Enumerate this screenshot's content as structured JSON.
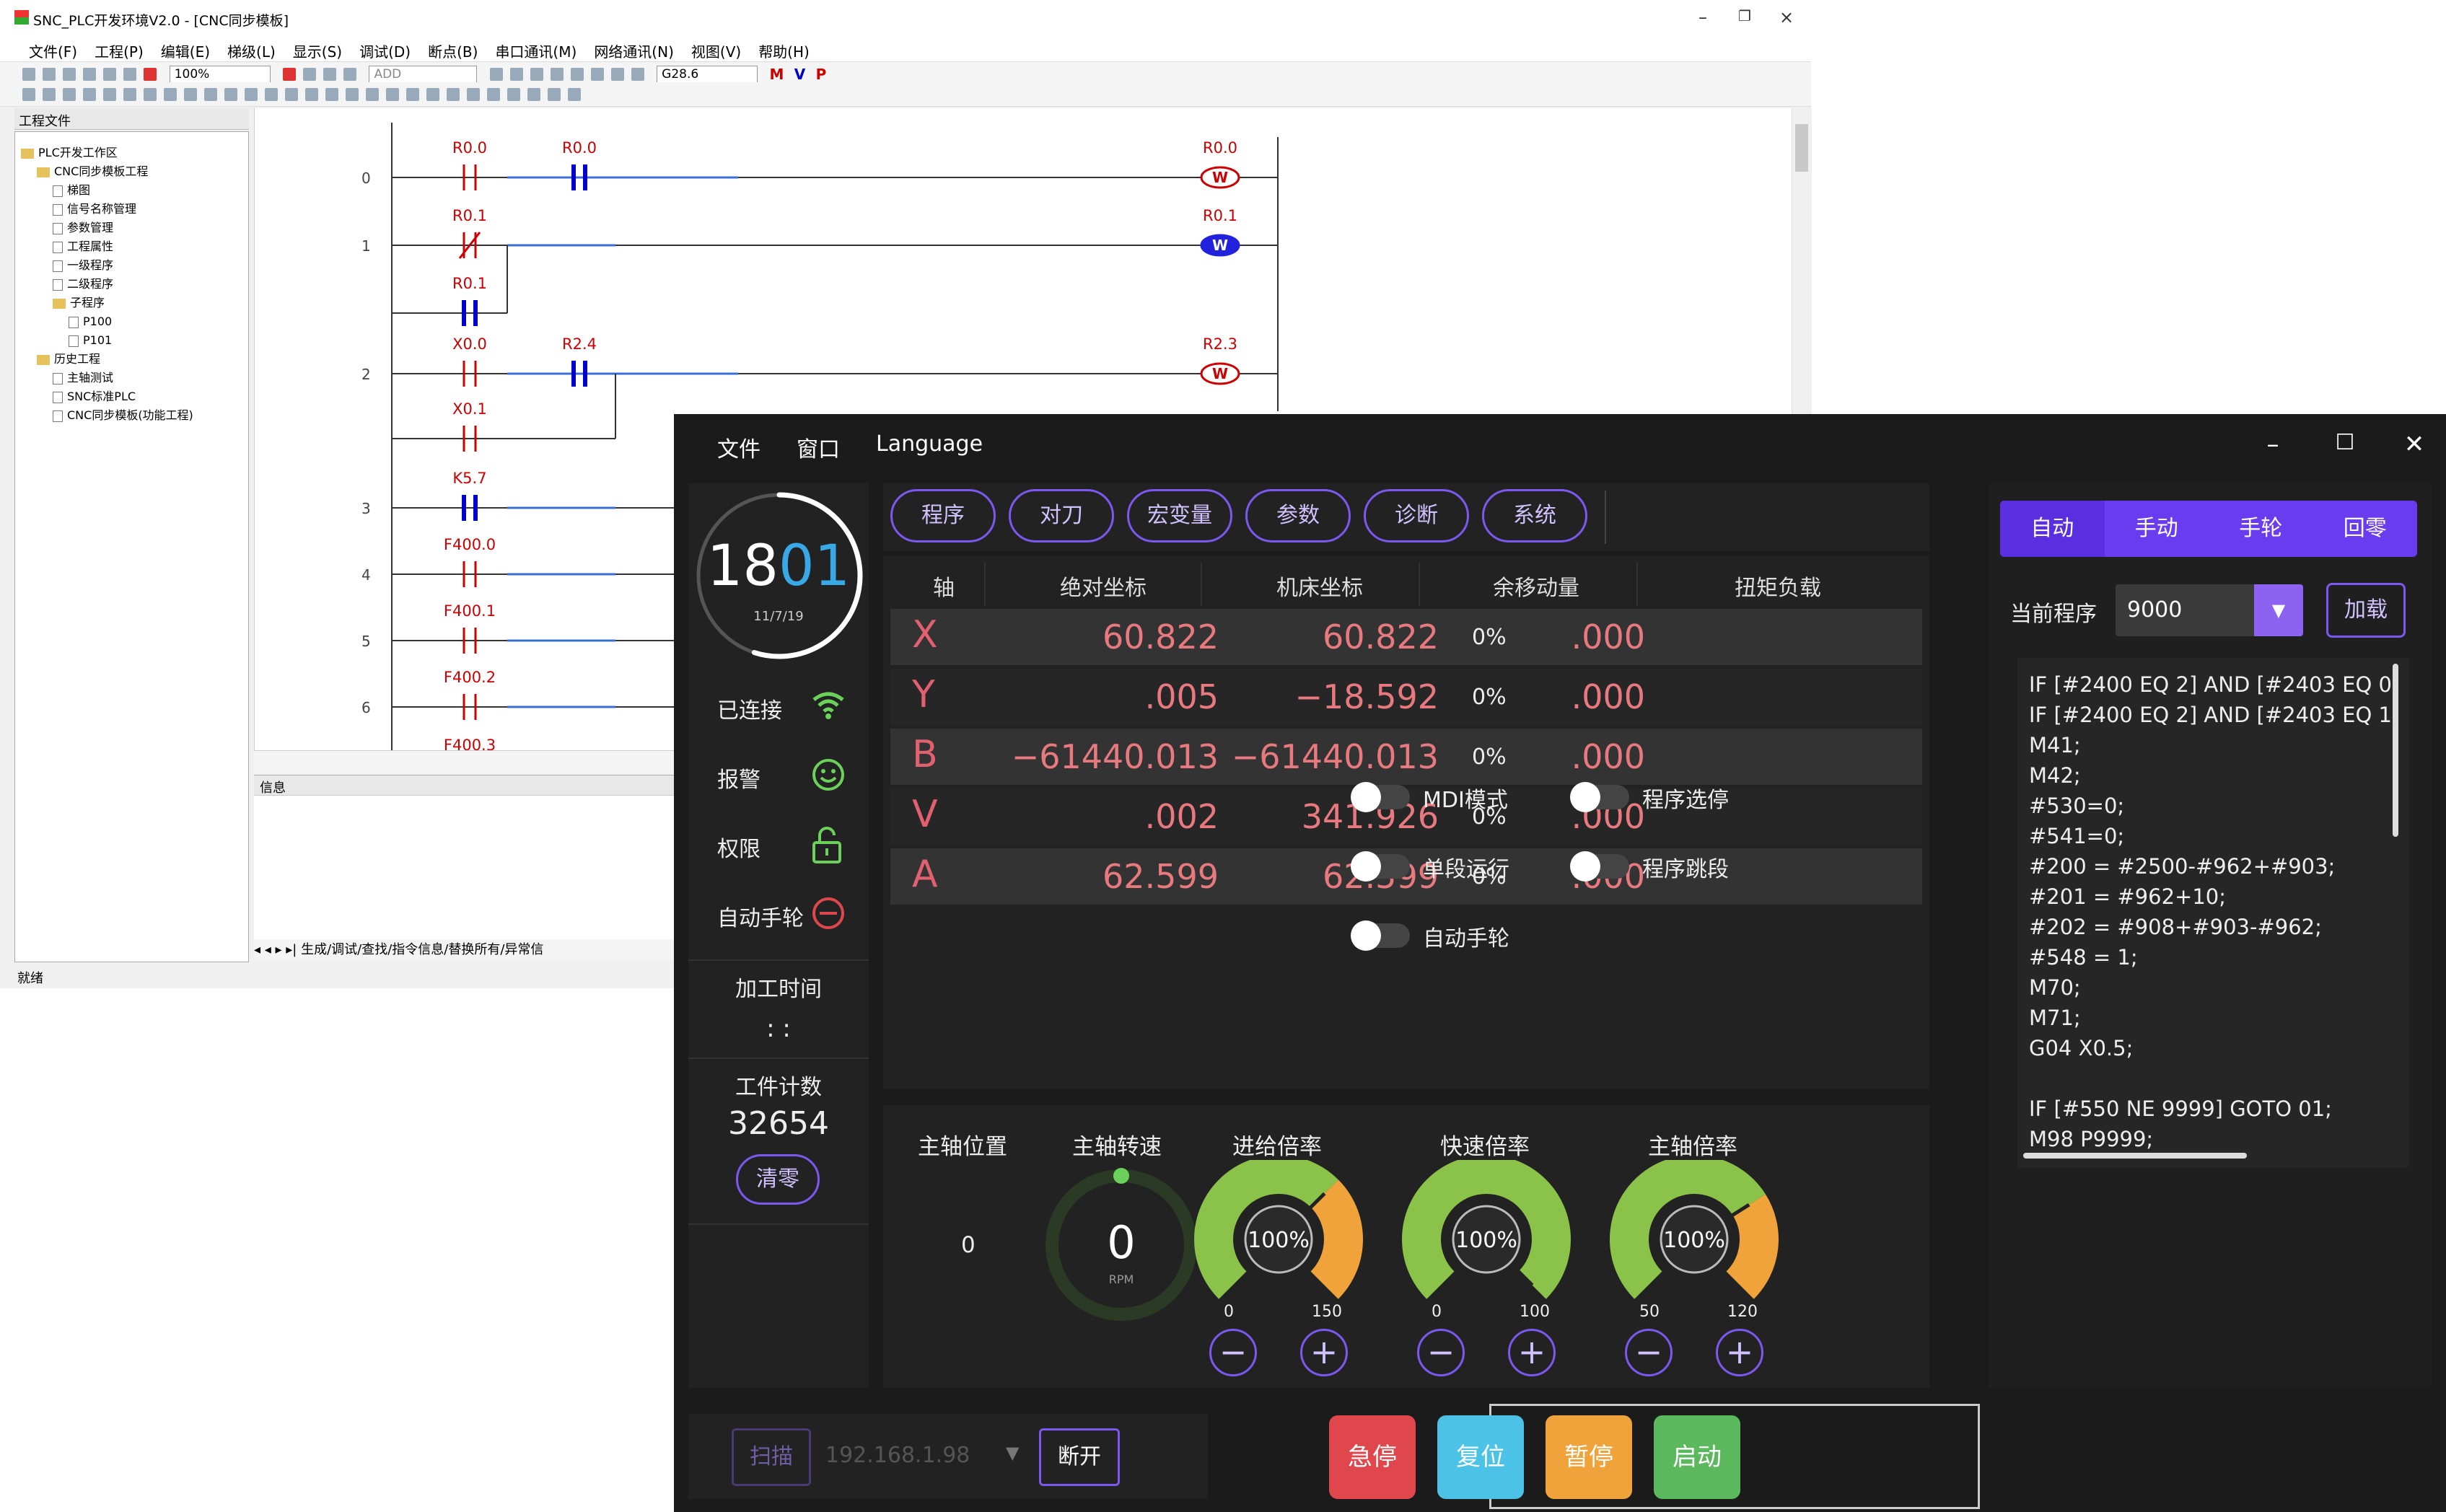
{
  "plc": {
    "title": "SNC_PLC开发环境V2.0 - [CNC同步模板]",
    "menu": [
      "文件(F)",
      "工程(P)",
      "编辑(E)",
      "梯级(L)",
      "显示(S)",
      "调试(D)",
      "断点(B)",
      "串口通讯(M)",
      "网络通讯(N)",
      "视图(V)",
      "帮助(H)"
    ],
    "zoom": "100%",
    "ins_field": "ADD",
    "coord_field": "G28.6",
    "toolbar_letters": [
      "M",
      "V",
      "P"
    ],
    "tree_header": "工程文件",
    "tree": [
      {
        "label": "PLC开发工作区",
        "level": 0,
        "type": "folder"
      },
      {
        "label": "CNC同步模板工程",
        "level": 1,
        "type": "folder"
      },
      {
        "label": "梯图",
        "level": 2,
        "type": "file"
      },
      {
        "label": "信号名称管理",
        "level": 2,
        "type": "file"
      },
      {
        "label": "参数管理",
        "level": 2,
        "type": "file"
      },
      {
        "label": "工程属性",
        "level": 2,
        "type": "file"
      },
      {
        "label": "一级程序",
        "level": 2,
        "type": "file"
      },
      {
        "label": "二级程序",
        "level": 2,
        "type": "file"
      },
      {
        "label": "子程序",
        "level": 2,
        "type": "folder"
      },
      {
        "label": "P100",
        "level": 3,
        "type": "file"
      },
      {
        "label": "P101",
        "level": 3,
        "type": "file"
      },
      {
        "label": "历史工程",
        "level": 1,
        "type": "folder"
      },
      {
        "label": "主轴测试",
        "level": 2,
        "type": "file"
      },
      {
        "label": "SNC标准PLC",
        "level": 2,
        "type": "file"
      },
      {
        "label": "CNC同步模板(功能工程)",
        "level": 2,
        "type": "file"
      }
    ],
    "rungs": [
      {
        "n": "0",
        "c1": "R0.0",
        "c2": "R0.0",
        "coil": "R0.0"
      },
      {
        "n": "1",
        "c1": "R0.1",
        "c2": "",
        "coil": "R0.1",
        "branch": "R0.1"
      },
      {
        "n": "2",
        "c1": "X0.0",
        "c2": "R2.4",
        "coil": "R2.3",
        "branch": "X0.1"
      },
      {
        "n": "3",
        "c1": "K5.7",
        "c2": "",
        "coil": ""
      },
      {
        "n": "4",
        "c1": "F400.0",
        "c2": "",
        "coil": ""
      },
      {
        "n": "5",
        "c1": "F400.1",
        "c2": "",
        "coil": ""
      },
      {
        "n": "6",
        "c1": "F400.2",
        "c2": "",
        "coil": ""
      },
      {
        "n": "",
        "c1": "F400.3",
        "c2": "",
        "coil": ""
      }
    ],
    "info_label": "信息",
    "bottom_tabs": "生成/调试/查找/指令信息/替换所有/异常信",
    "status": "就绪"
  },
  "cnc": {
    "menu": [
      "文件",
      "窗口",
      "Language"
    ],
    "clock": {
      "hour": "18",
      "minute": "01",
      "date": "11/7/19"
    },
    "status": [
      {
        "label": "已连接",
        "icon": "wifi-icon"
      },
      {
        "label": "报警",
        "icon": "smiley-icon"
      },
      {
        "label": "权限",
        "icon": "unlock-icon"
      },
      {
        "label": "自动手轮",
        "icon": "minus-circle-icon"
      }
    ],
    "machining_time_label": "加工时间",
    "machining_time": ": :",
    "count_label": "工件计数",
    "count": "32654",
    "clear_label": "清零",
    "tabs": [
      "程序",
      "对刀",
      "宏变量",
      "参数",
      "诊断",
      "系统"
    ],
    "table_headers": [
      "轴",
      "绝对坐标",
      "机床坐标",
      "余移动量",
      "扭矩负载"
    ],
    "axes": [
      {
        "axis": "X",
        "abs": "60.822",
        "mach": "60.822",
        "remain": ".000",
        "load": "0%"
      },
      {
        "axis": "Y",
        "abs": ".005",
        "mach": "−18.592",
        "remain": ".000",
        "load": "0%"
      },
      {
        "axis": "B",
        "abs": "−61440.013",
        "mach": "−61440.013",
        "remain": ".000",
        "load": "0%"
      },
      {
        "axis": "V",
        "abs": ".002",
        "mach": "341.926",
        "remain": ".000",
        "load": "0%"
      },
      {
        "axis": "A",
        "abs": "62.599",
        "mach": "62.599",
        "remain": ".000",
        "load": "0%"
      }
    ],
    "spindle_pos_label": "主轴位置",
    "spindle_pos": "0",
    "spindle_speed_label": "主轴转速",
    "spindle_speed": "0",
    "spindle_unit": "RPM",
    "gauges": [
      {
        "label": "进给倍率",
        "value": "100%",
        "min": "0",
        "max": "150",
        "fraction": 0.667
      },
      {
        "label": "快速倍率",
        "value": "100%",
        "min": "0",
        "max": "100",
        "fraction": 1.0
      },
      {
        "label": "主轴倍率",
        "value": "100%",
        "min": "50",
        "max": "120",
        "fraction": 0.714
      }
    ],
    "mode_tabs": [
      "自动",
      "手动",
      "手轮",
      "回零"
    ],
    "current_program_label": "当前程序",
    "current_program": "9000",
    "load_label": "加载",
    "code": [
      "IF [#2400 EQ 2] AND [#2403 EQ 0",
      "IF [#2400 EQ 2] AND [#2403 EQ 1",
      "M41;",
      "M42;",
      "#530=0;",
      "#541=0;",
      "#200 = #2500-#962+#903;",
      "#201 = #962+10;",
      "#202 = #908+#903-#962;",
      "#548 = 1;",
      "M70;",
      "M71;",
      "G04 X0.5;",
      "",
      "IF [#550 NE 9999] GOTO 01;",
      "M98 P9999;"
    ],
    "toggles": [
      "MDI模式",
      "程序选停",
      "单段运行",
      "程序跳段",
      "自动手轮"
    ],
    "scan_label": "扫描",
    "ip": "192.168.1.98",
    "disconnect_label": "断开",
    "buttons": [
      {
        "label": "急停",
        "color": "#e0474c"
      },
      {
        "label": "复位",
        "color": "#4cc3e6"
      },
      {
        "label": "暂停",
        "color": "#f0a33a"
      },
      {
        "label": "启动",
        "color": "#5cb85c"
      }
    ]
  }
}
